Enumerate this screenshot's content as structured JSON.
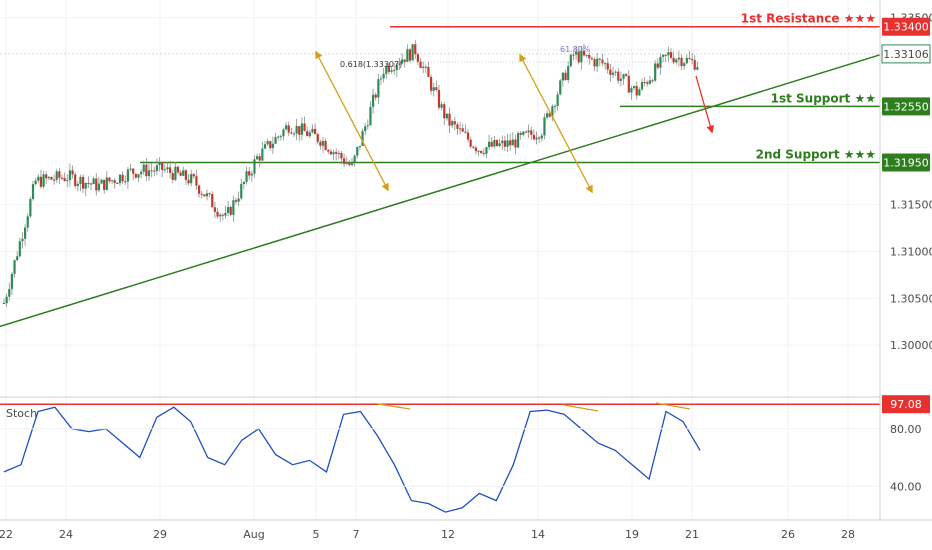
{
  "chart_data": [
    {
      "type": "line",
      "panel": "price",
      "description_values": "candlestick price (approx closes)",
      "x": [
        "22",
        "23",
        "24",
        "25",
        "26",
        "29",
        "30",
        "31",
        "Aug",
        "2",
        "5",
        "6",
        "7",
        "8",
        "9",
        "12",
        "13",
        "14",
        "15",
        "16",
        "19",
        "20",
        "21"
      ],
      "series": [
        {
          "values": [
            1.3045,
            1.3175,
            1.318,
            1.317,
            1.3185,
            1.3188,
            1.3175,
            1.3135,
            1.32,
            1.3235,
            1.322,
            1.319,
            1.3295,
            1.3315,
            1.324,
            1.321,
            1.3215,
            1.323,
            1.331,
            1.33,
            1.327,
            1.331,
            1.33
          ]
        }
      ],
      "ylim": [
        1.295,
        1.336
      ],
      "y_ticks": [
        "1.30000",
        "1.30500",
        "1.31000",
        "1.31500",
        "1.33500"
      ],
      "x_ticks": [
        "22",
        "24",
        "29",
        "Aug",
        "5",
        "7",
        "12",
        "14",
        "19",
        "21",
        "26",
        "28"
      ],
      "levels": [
        {
          "label": "1st Resistance ★★★",
          "value": "1.33400",
          "y": 1.334,
          "color": "#e8312f",
          "from_x": "8",
          "badge_bg": "#e8312f"
        },
        {
          "label": "1st Support ★★",
          "value": "1.32550",
          "y": 1.3255,
          "color": "#2e7d1f",
          "from_x": "19",
          "badge_bg": "#2e7d1f"
        },
        {
          "label": "2nd Support ★★★",
          "value": "1.31950",
          "y": 1.3195,
          "color": "#2e7d1f",
          "from_x": "28",
          "badge_bg": "#2e7d1f"
        }
      ],
      "current_price": {
        "value": "1.33106",
        "y": 1.3311
      },
      "trendline": {
        "from": {
          "x": "22",
          "y": 1.302
        },
        "to": {
          "x": "end",
          "y": 1.331
        }
      },
      "fib_label": "0.618(1.33307)",
      "fib2_label": "61.80%",
      "colors": {
        "up": "#2e8b57",
        "down": "#c0392b",
        "trend": "#2e7d1f",
        "arrow": "#d4a017",
        "projection": "#e8312f",
        "stoch": "#1f4fbf"
      }
    },
    {
      "type": "line",
      "panel": "stochastic",
      "title": "Stoch",
      "series": [
        {
          "values": [
            50,
            55,
            92,
            95,
            80,
            78,
            80,
            70,
            60,
            88,
            95,
            85,
            60,
            55,
            72,
            80,
            62,
            55,
            58,
            50,
            90,
            92,
            75,
            55,
            30,
            28,
            22,
            25,
            35,
            30,
            55,
            92,
            93,
            90,
            80,
            70,
            65,
            55,
            45,
            92,
            85,
            65
          ]
        }
      ],
      "ylim": [
        20,
        100
      ],
      "y_ticks": [
        "40.00",
        "80.00"
      ],
      "overbought": {
        "value": "97.08",
        "y": 97.08,
        "color": "#e8312f"
      }
    }
  ]
}
